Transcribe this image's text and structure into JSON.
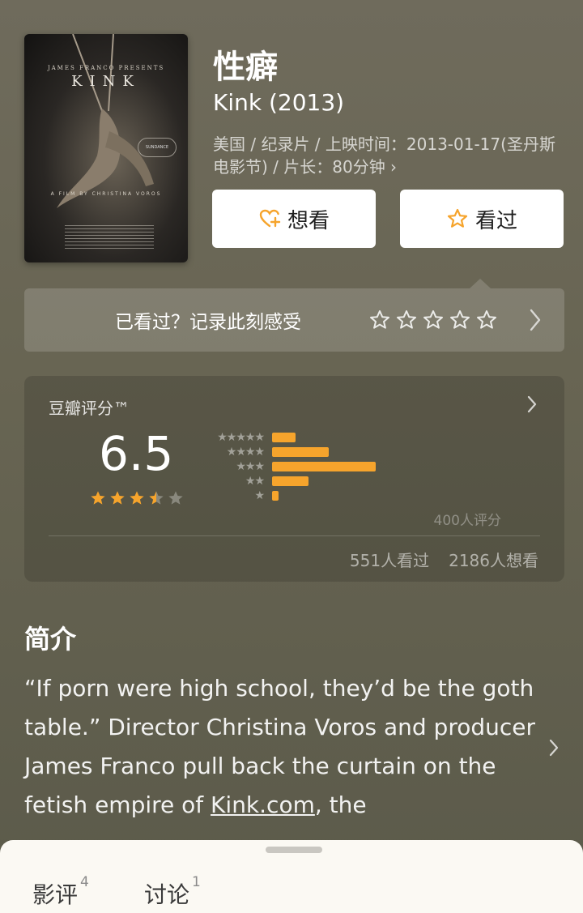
{
  "poster": {
    "presents": "JAMES FRANCO PRESENTS",
    "title": "KINK",
    "credit": "A FILM BY CHRISTINA VOROS",
    "laurel": "SUNDANCE"
  },
  "movie": {
    "title": "性癖",
    "original_title": "Kink (2013)",
    "meta": "美国 / 纪录片 / 上映时间：2013-01-17(圣丹斯电影节) / 片长：80分钟 ›"
  },
  "actions": {
    "want_label": "想看",
    "seen_label": "看过"
  },
  "rate_prompt": {
    "text": "已看过？记录此刻感受",
    "star_count": 5
  },
  "rating": {
    "label": "豆瓣评分™",
    "score": "6.5",
    "stars_value": 3.5,
    "stars_max": 5,
    "distribution": [
      {
        "stars": 5,
        "fraction": 0.23
      },
      {
        "stars": 4,
        "fraction": 0.55
      },
      {
        "stars": 3,
        "fraction": 1.0
      },
      {
        "stars": 2,
        "fraction": 0.35
      },
      {
        "stars": 1,
        "fraction": 0.06
      }
    ],
    "raters": "400人评分",
    "seen_count": "551人看过",
    "want_count": "2186人想看"
  },
  "synopsis": {
    "title": "简介",
    "text_before_link": "“If porn were high school, they’d be the goth table.” Director Christina Voros and producer James Franco pull back the curtain on the fetish empire of ",
    "link": "Kink.com",
    "text_after_link": ", the"
  },
  "sheet": {
    "tabs": [
      {
        "label": "影评",
        "count": "4"
      },
      {
        "label": "讨论",
        "count": "1"
      }
    ]
  },
  "colors": {
    "accent": "#f6a42c",
    "sheet_bg": "#fbf9f3"
  }
}
